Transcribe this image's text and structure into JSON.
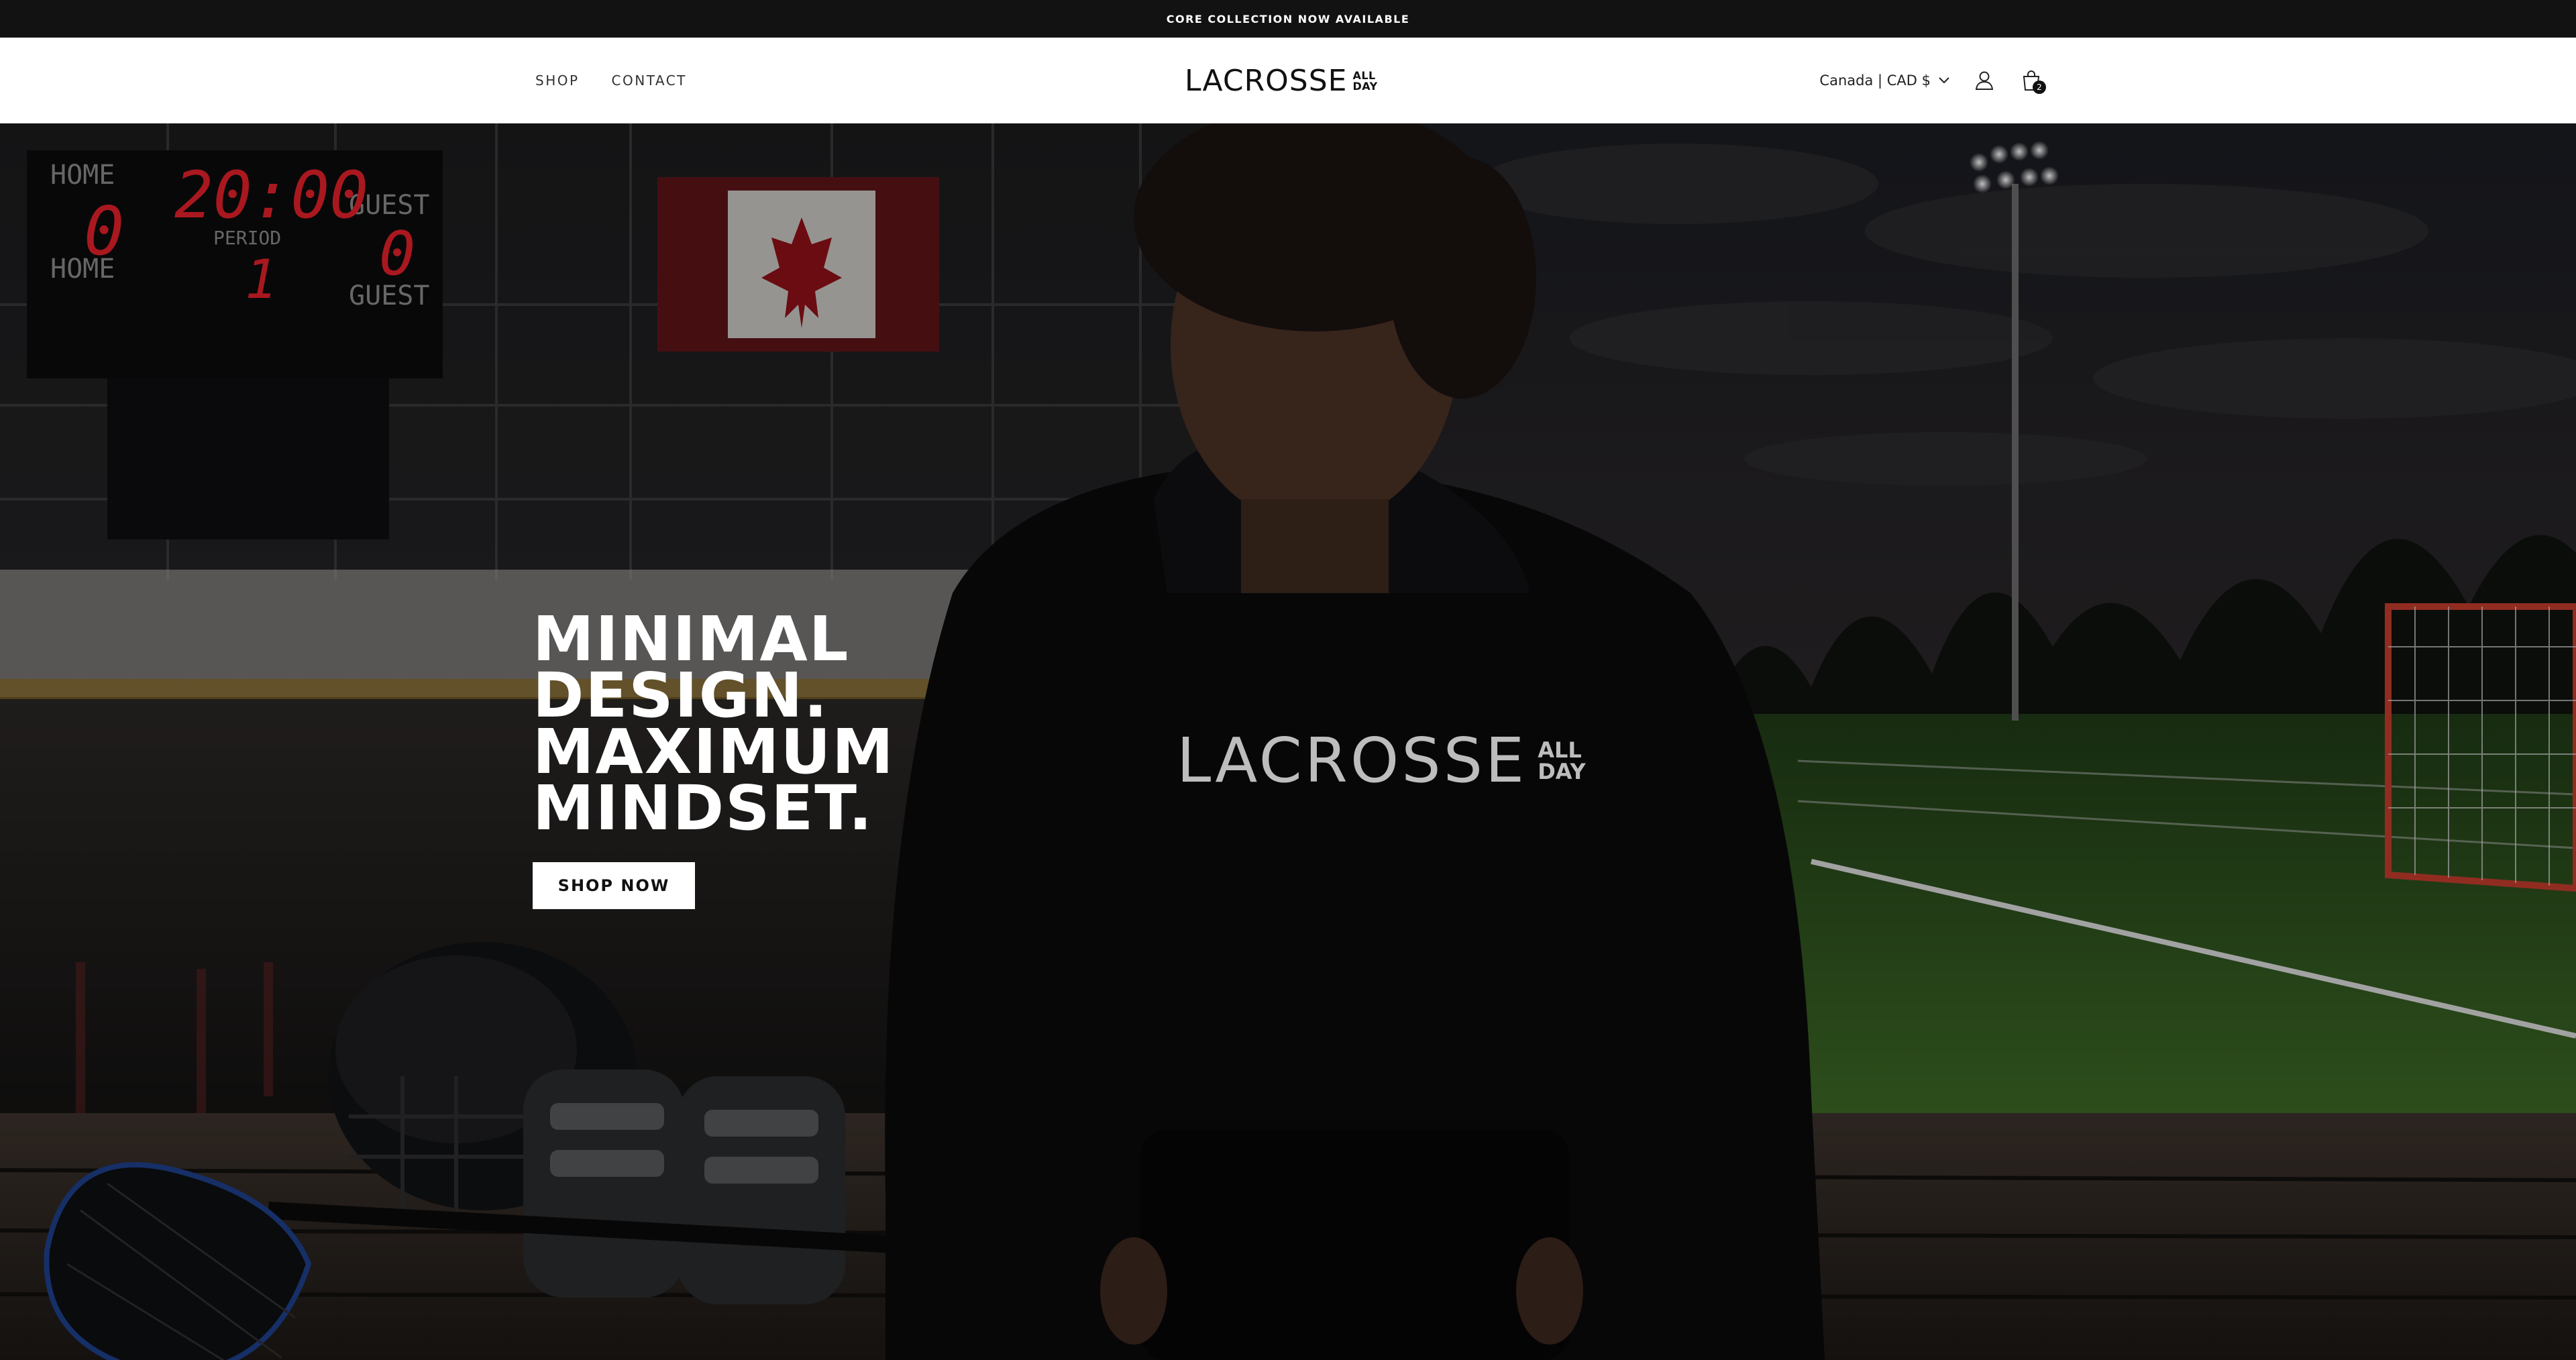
{
  "announcement": {
    "text": "CORE COLLECTION NOW AVAILABLE"
  },
  "nav": {
    "shop": "SHOP",
    "contact": "CONTACT"
  },
  "logo": {
    "main": "LACROSSE",
    "sub_top": "ALL",
    "sub_bottom": "DAY"
  },
  "header": {
    "locale": "Canada | CAD $",
    "account_icon": "user-icon",
    "cart_icon": "shopping-bag-icon",
    "cart_count": "2"
  },
  "hero": {
    "headline": [
      "MINIMAL",
      "DESIGN.",
      "MAXIMUM",
      "MINDSET."
    ],
    "cta": "SHOP NOW",
    "scoreboard": {
      "home_label": "HOME",
      "guest_label": "GUEST",
      "home_score": "0",
      "guest_score": "0",
      "clock": "20:00",
      "period_label": "PERIOD",
      "period": "1"
    }
  },
  "colors": {
    "announce_bg": "#121212",
    "header_bg": "#ffffff",
    "accent": "#ffffff",
    "scoreboard_red": "#e3202a"
  }
}
